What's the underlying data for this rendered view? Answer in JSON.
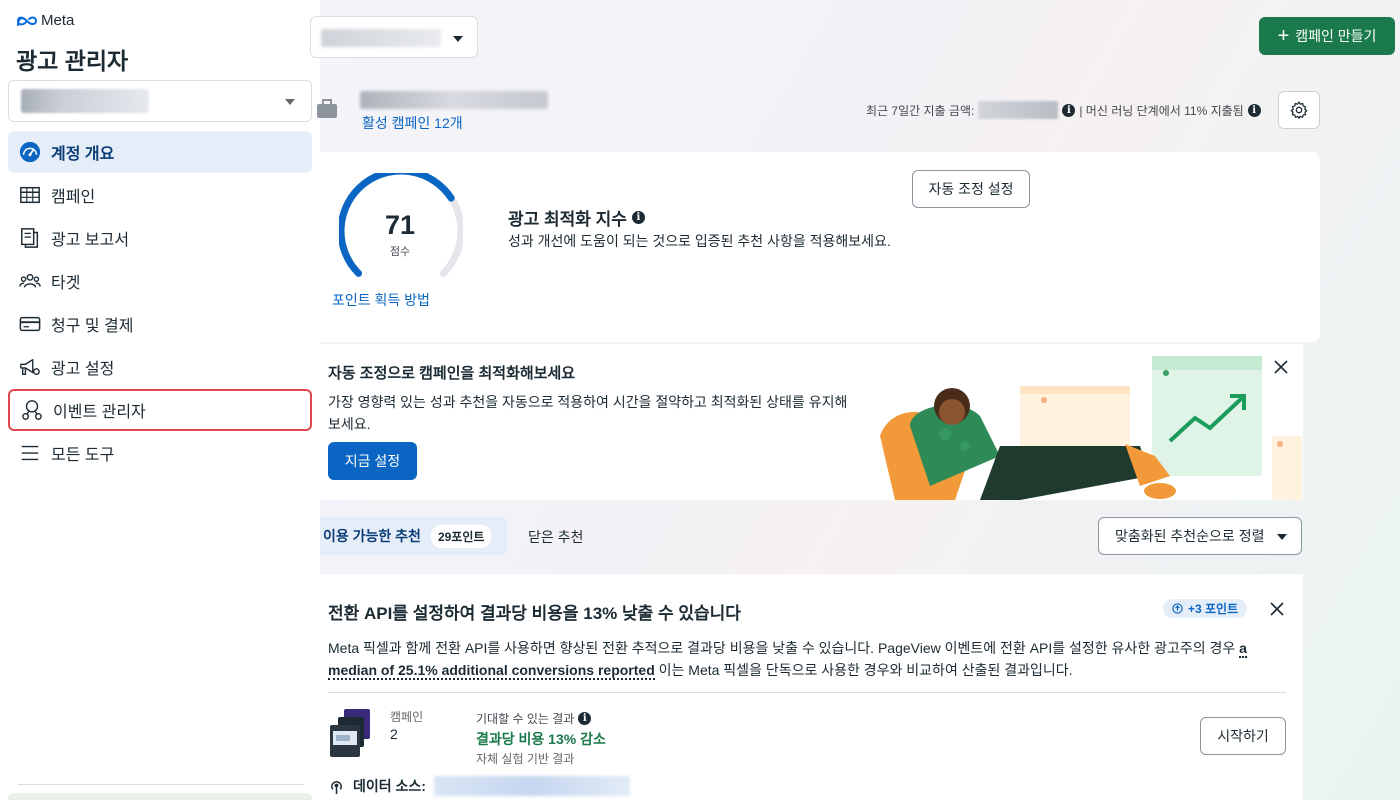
{
  "brand": {
    "logo_text": "Meta",
    "app_title": "광고 관리자"
  },
  "sidebar": {
    "items": [
      {
        "label": "계정 개요",
        "icon": "gauge-icon",
        "active": true
      },
      {
        "label": "캠페인",
        "icon": "table-icon"
      },
      {
        "label": "광고 보고서",
        "icon": "report-icon"
      },
      {
        "label": "타겟",
        "icon": "audience-icon"
      },
      {
        "label": "청구 및 결제",
        "icon": "credit-card-icon"
      },
      {
        "label": "광고 설정",
        "icon": "megaphone-settings-icon"
      },
      {
        "label": "이벤트 관리자",
        "icon": "events-manager-icon",
        "highlighted": true
      },
      {
        "label": "모든 도구",
        "icon": "menu-icon"
      }
    ]
  },
  "header": {
    "create_button": "캠페인 만들기",
    "active_campaigns": "활성 캠페인 12개",
    "spend_label": "최근 7일간 지출 금액:",
    "learning_label": "| 머신 러닝 단계에서 11% 지출됨"
  },
  "score": {
    "value": "71",
    "value_fraction": 0.71,
    "unit": "점수",
    "points_link": "포인트 획득 방법",
    "title": "광고 최적화 지수",
    "subtitle": "성과 개선에 도움이 되는 것으로 입증된 추천 사항을 적용해보세요.",
    "auto_adjust_button": "자동 조정 설정"
  },
  "promo": {
    "title": "자동 조정으로 캠페인을 최적화해보세요",
    "description": "가장 영향력 있는 성과 추천을 자동으로 적용하여 시간을 절약하고 최적화된 상태를 유지해보세요.",
    "button": "지금 설정"
  },
  "tabs": {
    "available_label": "이용 가능한 추천",
    "available_points": "29포인트",
    "dismissed_label": "닫은 추천",
    "sort_label": "맞춤화된 추천순으로 정렬"
  },
  "recommendation": {
    "title": "전환 API를 설정하여 결과당 비용을 13% 낮출 수 있습니다",
    "points": "+3 포인트",
    "desc_before": "Meta 픽셀과 함께 전환 API를 사용하면 향상된 전환 추적으로 결과당 비용을 낮출 수 있습니다. PageView 이벤트에 전환 API를 설정한 유사한 광고주의 경우 ",
    "desc_link": "a median of 25.1% additional conversions reported",
    "desc_after": " 이는 Meta 픽셀을 단독으로 사용한 경우와 비교하여 산출된 결과입니다.",
    "campaign_label": "캠페인",
    "campaign_count": "2",
    "expected_label": "기대할 수 있는 결과",
    "expected_value": "결과당 비용 13% 감소",
    "expected_note": "자체 실험 기반 결과",
    "start_button": "시작하기",
    "datasource_label": "데이터 소스:"
  },
  "colors": {
    "primary_blue": "#0a66c2",
    "create_green": "#1b7a4b",
    "highlight_red": "#e0474c",
    "active_nav_bg": "#e5eef8"
  }
}
